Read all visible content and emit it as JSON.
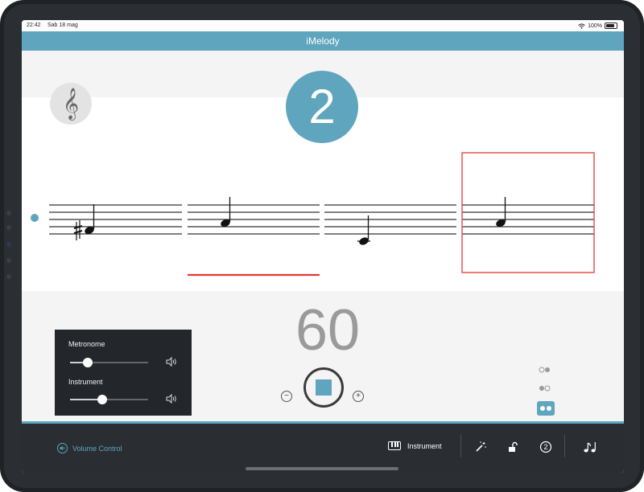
{
  "status_bar": {
    "time": "22:42",
    "date": "Sab 18 mag",
    "battery": "100%"
  },
  "app": {
    "title": "iMelody"
  },
  "clef_button": {
    "icon": "treble-clef-icon",
    "symbol": "𝄞"
  },
  "count": "2",
  "colors": {
    "accent": "#5ea5bd",
    "highlight": "#e53935",
    "toolbar": "#2a2e33",
    "volume_box": "#23272b"
  },
  "volume_control": {
    "metronome_label": "Metronome",
    "metronome_level": 0.23,
    "instrument_label": "Instrument",
    "instrument_level": 0.41
  },
  "tempo": "60",
  "tempo_minus": "−",
  "tempo_plus": "+",
  "toolbar": {
    "volume_label": "Volume Control",
    "instrument_label": "Instrument",
    "count_badge": "2"
  }
}
